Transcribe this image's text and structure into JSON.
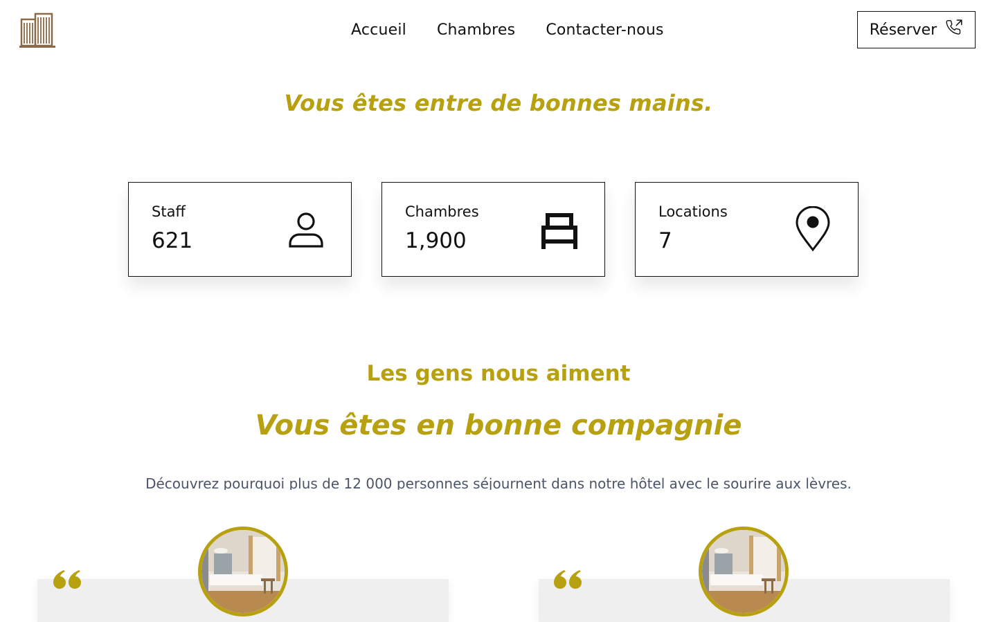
{
  "header": {
    "logo_icon": "hotel-building-icon",
    "nav": [
      {
        "label": "Accueil"
      },
      {
        "label": "Chambres"
      },
      {
        "label": "Contacter-nous"
      }
    ],
    "reserve_label": "Réserver",
    "reserve_icon": "phone-outgoing-icon"
  },
  "hero": {
    "tagline": "Vous êtes entre de bonnes mains."
  },
  "stats": [
    {
      "label": "Staff",
      "value": "621",
      "icon": "person-icon"
    },
    {
      "label": "Chambres",
      "value": "1,900",
      "icon": "bed-icon"
    },
    {
      "label": "Locations",
      "value": "7",
      "icon": "map-pin-icon"
    }
  ],
  "testimonials": {
    "subheading": "Les gens nous aiment",
    "heading": "Vous êtes en bonne compagnie",
    "intro": "Découvrez pourquoi plus de 12 000 personnes séjournent dans notre hôtel avec le sourire aux lèvres.",
    "cards": [
      {
        "image": "hotel-room-photo",
        "quote_icon": "quote-icon"
      },
      {
        "image": "hotel-room-photo",
        "quote_icon": "quote-icon"
      }
    ]
  },
  "colors": {
    "accent": "#b8a110",
    "text": "#111111",
    "muted": "#4a5568",
    "card_bg": "#efefef",
    "logo_brown": "#8a6a47"
  }
}
